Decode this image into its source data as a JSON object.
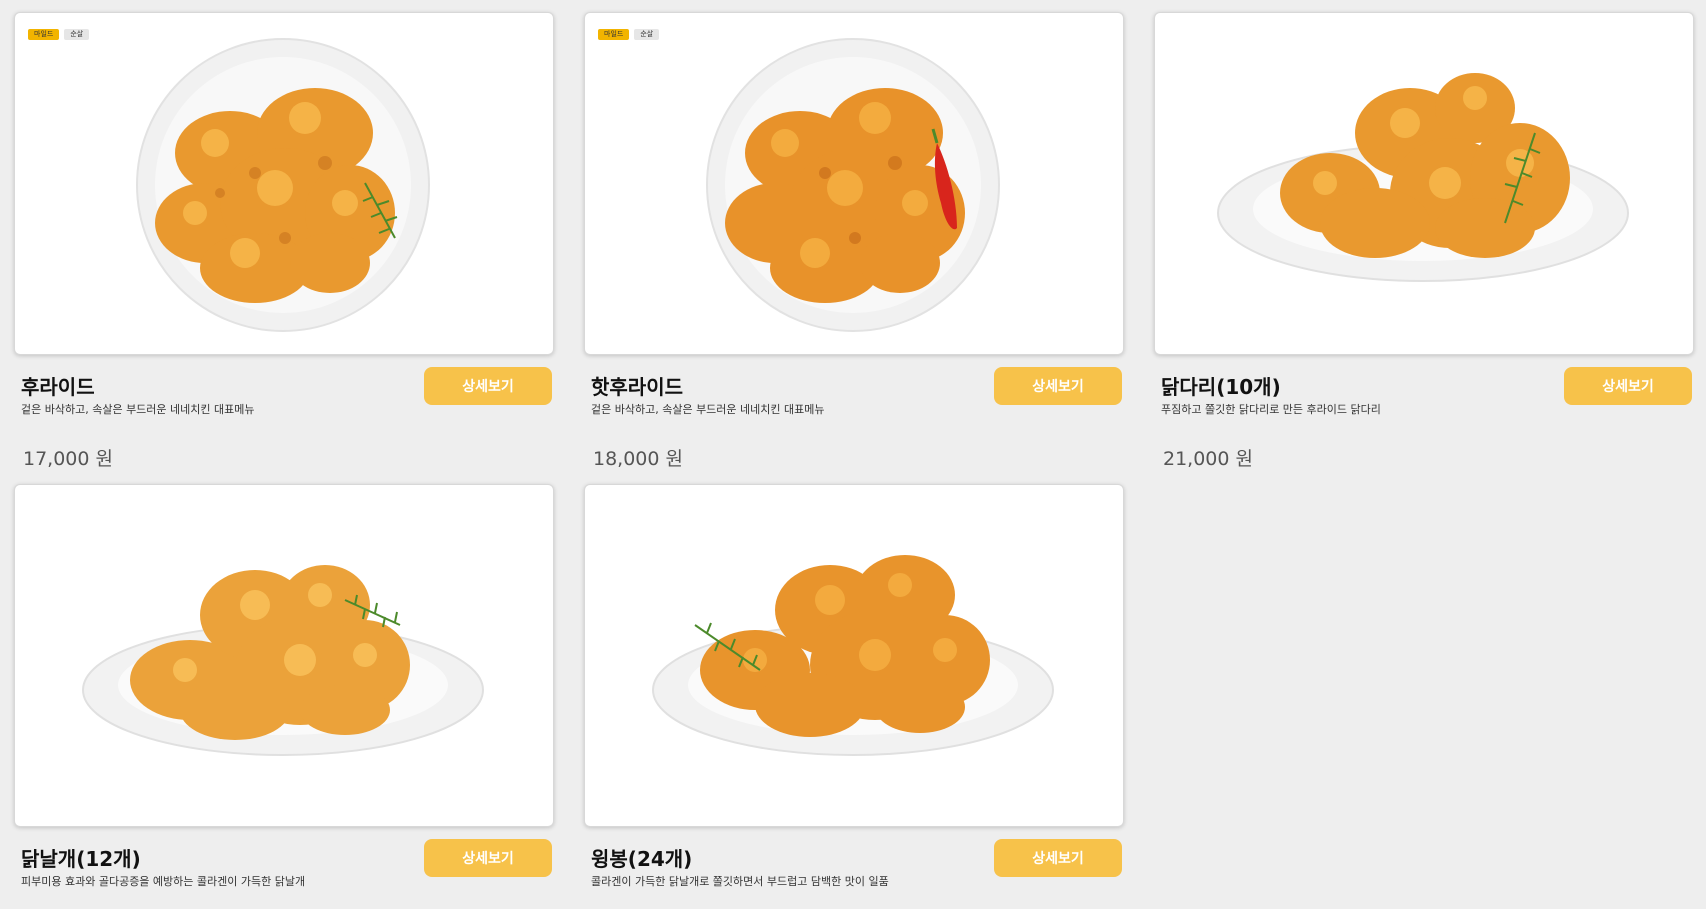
{
  "menu": {
    "items": [
      {
        "name": "후라이드",
        "description": "겉은 바삭하고, 속살은 부드러운 네네치킨 대표메뉴",
        "price": "17,000 원",
        "button_label": "상세보기",
        "badges": [
          "마일드",
          "순살"
        ],
        "garnish": "rosemary",
        "plate": "top-view"
      },
      {
        "name": "핫후라이드",
        "description": "겉은 바삭하고, 속살은 부드러운 네네치킨 대표메뉴",
        "price": "18,000 원",
        "button_label": "상세보기",
        "badges": [
          "마일드",
          "순살"
        ],
        "garnish": "red-pepper",
        "plate": "top-view"
      },
      {
        "name": "닭다리(10개)",
        "description": "푸짐하고 쫄깃한 닭다리로 만든 후라이드 닭다리",
        "price": "21,000 원",
        "button_label": "상세보기",
        "badges": [],
        "garnish": "rosemary",
        "plate": "side-view"
      },
      {
        "name": "닭날개(12개)",
        "description": "피부미용 효과와 골다공증을 예방하는 콜라겐이 가득한 닭날개",
        "price": "",
        "button_label": "상세보기",
        "badges": [],
        "garnish": "rosemary",
        "plate": "side-view"
      },
      {
        "name": "윙봉(24개)",
        "description": "콜라겐이 가득한 닭날개로 쫄깃하면서 부드럽고 담백한 맛이 일품",
        "price": "",
        "button_label": "상세보기",
        "badges": [],
        "garnish": "rosemary",
        "plate": "side-view"
      }
    ]
  },
  "colors": {
    "page_background": "#eeeeee",
    "button": "#f7c24a",
    "badge_mild": "#f2b400",
    "badge_boneless": "#e6e6e6",
    "chicken": "#e9992f"
  }
}
